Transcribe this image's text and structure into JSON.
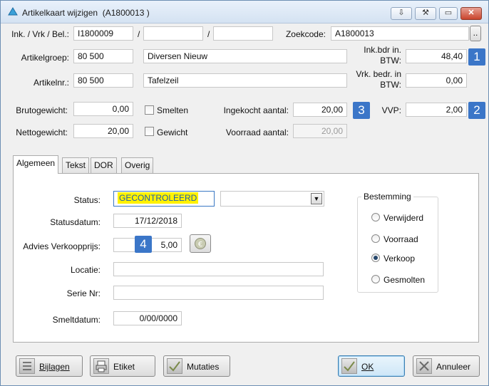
{
  "window": {
    "title": "Artikelkaart wijzigen",
    "code": "(A1800013 )",
    "controls": {
      "collapse": "⇩",
      "pin": "⚒",
      "minimize": "▭",
      "close": "✕"
    }
  },
  "top": {
    "ink_label": "Ink. / Vrk / Bel.:",
    "ink1": "I1800009",
    "sep1": "/",
    "ink2": "",
    "sep2": "/",
    "ink3": "",
    "zoek_label": "Zoekcode:",
    "zoek_value": "A1800013",
    "browse": ".."
  },
  "art": {
    "groep_label": "Artikelgroep:",
    "groep_code": "80 500",
    "groep_desc": "Diversen Nieuw",
    "nr_label": "Artikelnr.:",
    "nr_code": "80 500",
    "nr_desc": "Tafelzeil",
    "inkbdr_label1": "Ink.bdr in.",
    "inkbdr_label2": "BTW:",
    "inkbdr_value": "48,40",
    "vrkbdr_label1": "Vrk. bedr. in",
    "vrkbdr_label2": "BTW:",
    "vrkbdr_value": "0,00"
  },
  "weights": {
    "bruto_label": "Brutogewicht:",
    "bruto_value": "0,00",
    "netto_label": "Nettogewicht:",
    "netto_value": "20,00",
    "smelten_label": "Smelten",
    "gewicht_label": "Gewicht",
    "ingekocht_label": "Ingekocht aantal:",
    "ingekocht_value": "20,00",
    "voorraad_label": "Voorraad aantal:",
    "voorraad_value": "20,00",
    "vvp_label": "VVP:",
    "vvp_value": "2,00"
  },
  "badges": {
    "b1": "1",
    "b2": "2",
    "b3": "3",
    "b4": "4"
  },
  "tabs": [
    {
      "label": "Algemeen"
    },
    {
      "label": "Tekst"
    },
    {
      "label": "DOR"
    },
    {
      "label": "Overig"
    }
  ],
  "general": {
    "status_label": "Status:",
    "status_value": "GECONTROLEERD",
    "status_select": "",
    "statusdatum_label": "Statusdatum:",
    "statusdatum_value": "17/12/2018",
    "advies_label": "Advies Verkoopprijs:",
    "advies_value": "5,00",
    "locatie_label": "Locatie:",
    "locatie_value": "",
    "serie_label": "Serie Nr:",
    "serie_value": "",
    "smelt_label": "Smeltdatum:",
    "smelt_value": "0/00/0000"
  },
  "bestemming": {
    "title": "Bestemming",
    "options": [
      "Verwijderd",
      "Voorraad",
      "Verkoop",
      "Gesmolten"
    ],
    "selected": "Verkoop"
  },
  "buttons": {
    "bijlagen": "Bijlagen",
    "etiket": "Etiket",
    "mutaties": "Mutaties",
    "ok": "OK",
    "annuleer": "Annuleer"
  }
}
